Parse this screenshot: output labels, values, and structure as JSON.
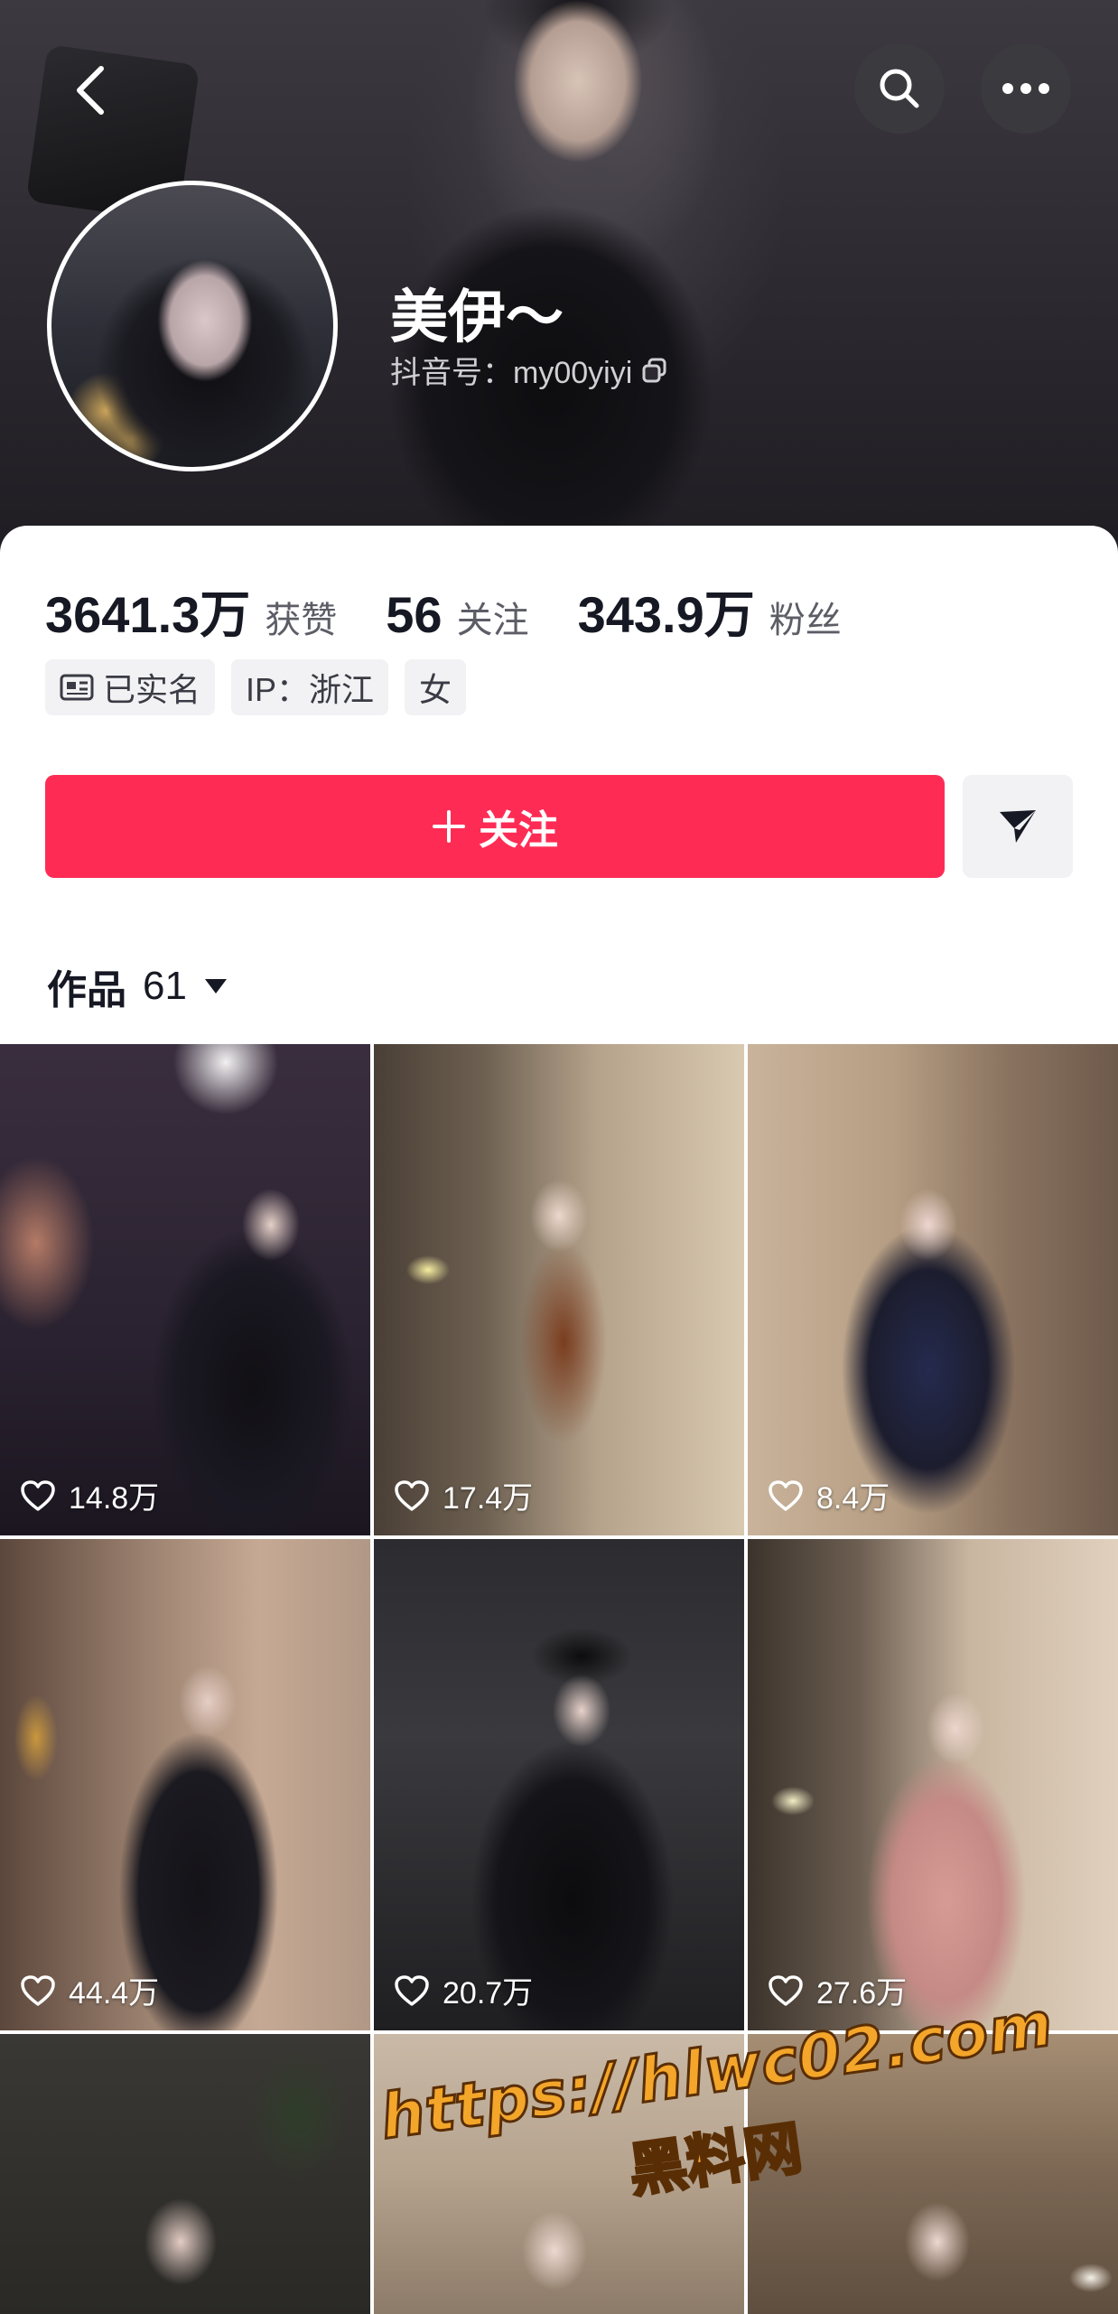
{
  "header": {
    "back_icon": "chevron-left-icon",
    "search_icon": "search-icon",
    "more_icon": "more-horizontal-icon"
  },
  "profile": {
    "nickname": "美伊～",
    "douyin_id": "抖音号：my00yiyi",
    "copy_icon": "copy-icon"
  },
  "stats": [
    {
      "value": "3641.3万",
      "label": "获赞"
    },
    {
      "value": "56",
      "label": "关注"
    },
    {
      "value": "343.9万",
      "label": "粉丝"
    }
  ],
  "tags": [
    {
      "icon": "id-card-icon",
      "label": "已实名"
    },
    {
      "label": "IP：浙江"
    },
    {
      "label": "女"
    }
  ],
  "actions": {
    "follow_label": "关注",
    "follow_icon": "plus-icon",
    "share_icon": "send-icon",
    "accent_color": "#fe2c55"
  },
  "works_tab": {
    "label": "作品",
    "count": "61",
    "dropdown_icon": "triangle-down-icon"
  },
  "videos": [
    {
      "likes": "14.8万"
    },
    {
      "likes": "17.4万"
    },
    {
      "likes": "8.4万"
    },
    {
      "likes": "44.4万"
    },
    {
      "likes": "20.7万"
    },
    {
      "likes": "27.6万"
    },
    {
      "likes": ""
    },
    {
      "likes": ""
    },
    {
      "likes": ""
    }
  ],
  "watermark": {
    "url": "https://hlwc02.com",
    "site": "黑料网"
  }
}
